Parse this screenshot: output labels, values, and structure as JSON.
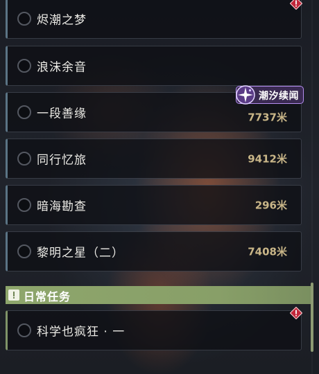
{
  "quests": [
    {
      "title": "烬潮之梦",
      "distance": ""
    },
    {
      "title": "浪沫余音",
      "distance": ""
    },
    {
      "title": "一段善缘",
      "distance": "7737米"
    },
    {
      "title": "同行忆旅",
      "distance": "9412米"
    },
    {
      "title": "暗海勘查",
      "distance": "296米"
    },
    {
      "title": "黎明之星（二）",
      "distance": "7408米"
    }
  ],
  "tag_badge": {
    "label": "潮汐续闻",
    "color": "#b48ef0"
  },
  "daily_section": {
    "title": "日常任务",
    "color": "#8ea66c"
  },
  "daily_quests": [
    {
      "title": "科学也疯狂 · 一",
      "distance": ""
    }
  ],
  "icons": {
    "alert": "diamond-alert-icon",
    "tag": "sparkle-badge-icon",
    "section": "exclamation-icon"
  },
  "colors": {
    "alert_red": "#c2273a",
    "distance_gold": "#c9b688",
    "row_accent": "#5b7485"
  }
}
